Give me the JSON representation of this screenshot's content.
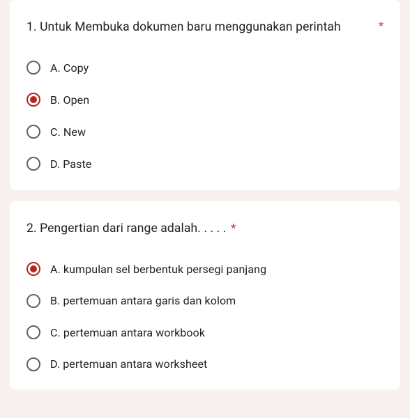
{
  "questions": [
    {
      "number": "1.",
      "text": "Untuk Membuka dokumen baru menggunakan perintah",
      "required": true,
      "requiredInline": false,
      "options": [
        {
          "label": "A. Copy",
          "selected": false
        },
        {
          "label": "B. Open",
          "selected": true
        },
        {
          "label": "C.  New",
          "selected": false
        },
        {
          "label": "D. Paste",
          "selected": false
        }
      ]
    },
    {
      "number": "2.",
      "text": " Pengertian dari range adalah. . . . .",
      "required": true,
      "requiredInline": true,
      "options": [
        {
          "label": "A. kumpulan sel berbentuk persegi panjang",
          "selected": true
        },
        {
          "label": "B.  pertemuan antara garis dan kolom",
          "selected": false
        },
        {
          "label": "C. pertemuan antara workbook",
          "selected": false
        },
        {
          "label": "D. pertemuan antara worksheet",
          "selected": false
        }
      ]
    }
  ],
  "requiredMark": "*"
}
